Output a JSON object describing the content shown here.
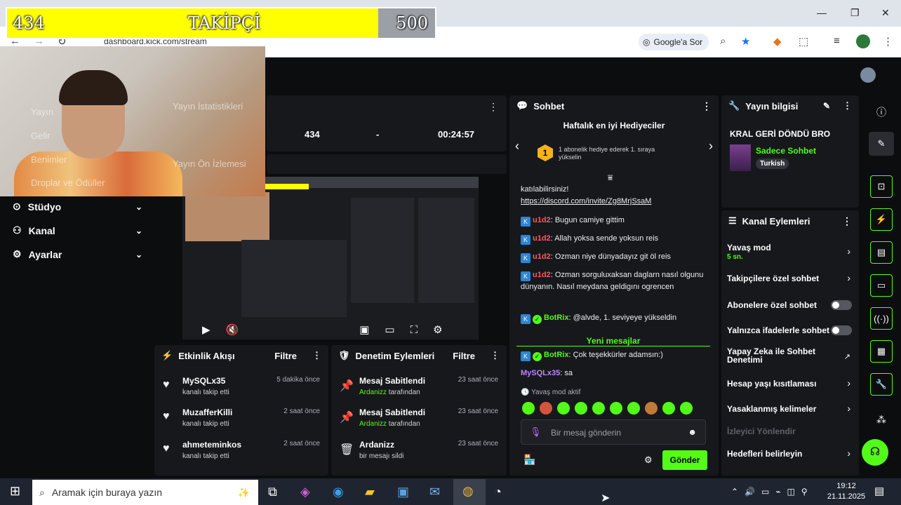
{
  "browser": {
    "url": "dashboard.kick.com/stream",
    "google_sor": "Google'a Sor"
  },
  "follower_goal": {
    "current": "434",
    "label": "TAKİPÇİ",
    "target": "500",
    "progress": 0.868
  },
  "webcam_overlay_text": {
    "yayin": "Yayın",
    "gelir": "Gelir",
    "benimler": "Benimler",
    "droplar": "Droplar ve Ödüller",
    "stats": "Yayın İstatistikleri",
    "onizleme": "Yayın Ön İzlemesi"
  },
  "sidebar": {
    "items": [
      {
        "label": "Stüdyo",
        "icon": "studio-icon"
      },
      {
        "label": "Kanal",
        "icon": "channel-icon"
      },
      {
        "label": "Ayarlar",
        "icon": "gear-icon"
      }
    ]
  },
  "stats": {
    "followers": "434",
    "dash": "-",
    "time": "00:24:57"
  },
  "activity": {
    "title": "Etkinlik Akışı",
    "filter": "Filtre",
    "rows": [
      {
        "name": "MySQLx35",
        "action": "kanalı takip etti",
        "time": "5 dakika önce"
      },
      {
        "name": "MuzafferKilli",
        "action": "kanalı takip etti",
        "time": "2 saat önce"
      },
      {
        "name": "ahmeteminkos",
        "action": "kanalı takip etti",
        "time": "2 saat önce"
      }
    ]
  },
  "moderation": {
    "title": "Denetim Eylemleri",
    "filter": "Filtre",
    "rows": [
      {
        "title": "Mesaj Sabitlendi",
        "who": "Ardanizz",
        "suffix": "tarafından",
        "time": "23 saat önce"
      },
      {
        "title": "Mesaj Sabitlendi",
        "who": "Ardanizz",
        "suffix": "tarafından",
        "time": "23 saat önce"
      },
      {
        "title": "Ardanizz",
        "who": "",
        "suffix": "bir mesajı sildi",
        "time": "23 saat önce"
      }
    ]
  },
  "chat": {
    "title": "Sohbet",
    "gifters_title": "Haftalık en iyi Hediyeciler",
    "gifter_rank": "1",
    "gifter_text": "1 abonelik hediye ederek 1. sıraya yükselin",
    "msg0": "katılabilirsiniz!",
    "link": "https://discord.com/invite/Zg8MrjSsaM",
    "messages": [
      {
        "user": "u1d2",
        "text": "Bugun camiye gittim"
      },
      {
        "user": "u1d2",
        "text": "Allah yoksa sende yoksun reis"
      },
      {
        "user": "u1d2",
        "text": "Ozman niye dünyadayız git öl reis"
      },
      {
        "user": "u1d2",
        "text": "Ozman sorguluxaksan daglarn nasıl olgunu dünyanın. Nasıl meydana geldigını ogrencen"
      }
    ],
    "botrix1_user": "BotRix",
    "botrix1_text": "@alvde, 1. seviyeye yükseldin",
    "new_messages": "Yeni mesajlar",
    "botrix2_user": "BotRix",
    "botrix2_text": "Çok teşekkürler adamsın:)",
    "mysql_user": "MySQLx35",
    "mysql_text": "sa",
    "slow_mode": "Yavaş mod aktif",
    "placeholder": "Bir mesaj gönderin",
    "send": "Gönder"
  },
  "stream_info": {
    "title": "Yayın bilgisi",
    "stream_title": "KRAL GERİ DÖNDÜ BRO",
    "category": "Sadece Sohbet",
    "language": "Turkish"
  },
  "channel_actions": {
    "title": "Kanal Eylemleri",
    "slow_mode": "Yavaş mod",
    "slow_mode_value": "5 sn.",
    "followers_only": "Takipçilere özel sohbet",
    "subscribers_only": "Abonelere özel sohbet",
    "emotes_only": "Yalnızca ifadelerle sohbet",
    "ai_moderation": "Yapay Zeka ile Sohbet Denetimi",
    "account_age": "Hesap yaşı kısıtlaması",
    "banned_words": "Yasaklanmış kelimeler",
    "viewer_redirect": "İzleyici Yönlendir",
    "set_goals": "Hedefleri belirleyin"
  },
  "taskbar": {
    "search_placeholder": "Aramak için buraya yazın",
    "time": "19:12",
    "date": "21.11.2025"
  },
  "colors": {
    "accent": "#53fc18",
    "yellow": "#ffff00",
    "panel": "#17181c"
  }
}
